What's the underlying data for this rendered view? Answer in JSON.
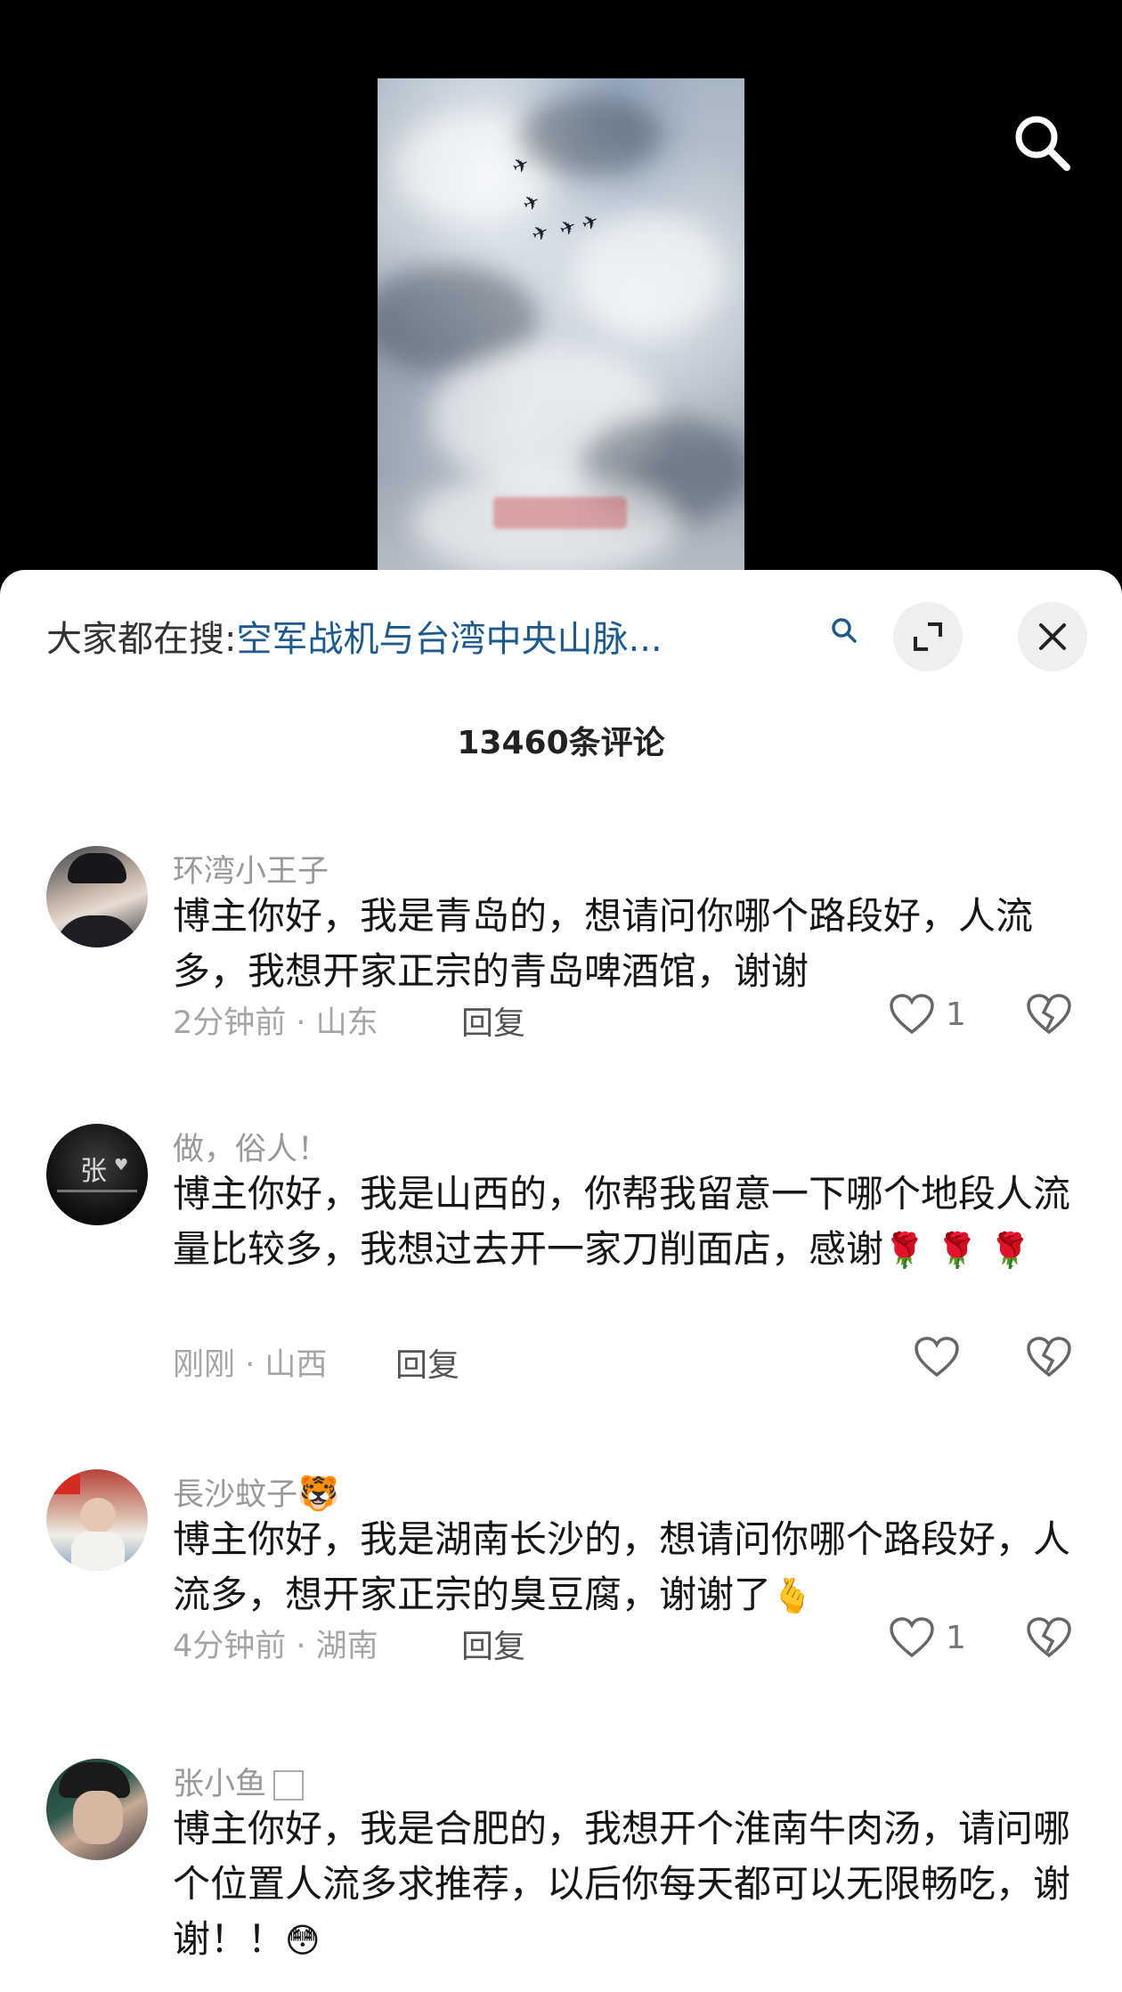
{
  "search_banner": {
    "prefix": "大家都在搜:",
    "query": "空军战机与台湾中央山脉..."
  },
  "comments_header": {
    "count_title": "13460条评论"
  },
  "comments": [
    {
      "username": "环湾小王子",
      "text": "博主你好，我是青岛的，想请问你哪个路段好，人流多，我想开家正宗的青岛啤酒馆，谢谢",
      "time_location": "2分钟前 · 山东",
      "reply_label": "回复",
      "likes": "1"
    },
    {
      "username": "做，俗人！",
      "text": "博主你好，我是山西的，你帮我留意一下哪个地段人流量比较多，我想过去开一家刀削面店，感谢",
      "emoji": "🌹 🌹 🌹",
      "time_location": "刚刚 · 山西",
      "reply_label": "回复",
      "likes": ""
    },
    {
      "username": "長沙蚊子",
      "username_emoji": "🐯",
      "text": "博主你好，我是湖南长沙的，想请问你哪个路段好，人流多，想开家正宗的臭豆腐，谢谢了",
      "emoji": "🫰",
      "time_location": "4分钟前 · 湖南",
      "reply_label": "回复",
      "likes": "1"
    },
    {
      "username": "张小鱼",
      "text": "博主你好，我是合肥的，我想开个淮南牛肉汤，请问哪个位置人流多求推荐，以后你每天都可以无限畅吃，谢谢！！",
      "emoji": "😳"
    }
  ],
  "avatar_texts": {
    "comment2": "张"
  },
  "colors": {
    "accent_link": "#1f5a8f",
    "meta_gray": "#a5a5a5",
    "username_gray": "#999999"
  },
  "icons": [
    "search-icon",
    "mini-search-icon",
    "expand-icon",
    "close-icon",
    "heart-icon",
    "broken-heart-icon"
  ]
}
